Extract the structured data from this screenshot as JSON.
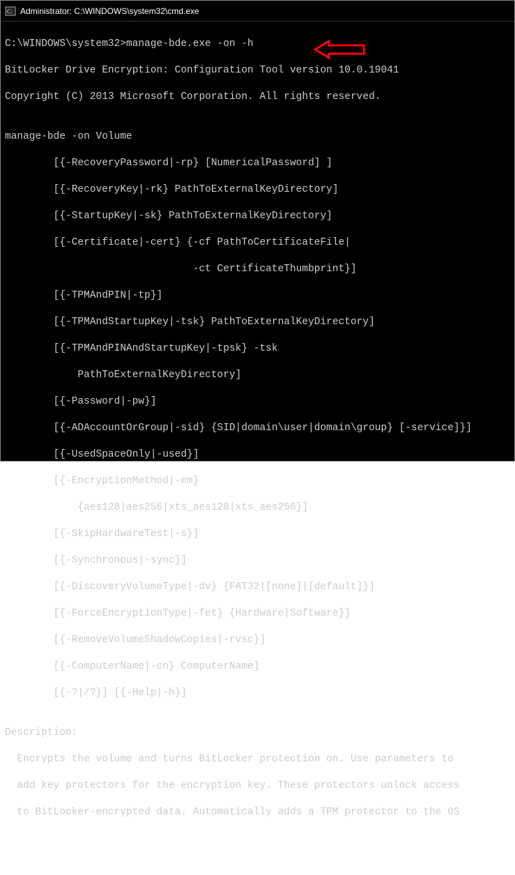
{
  "titlebar": {
    "title": "Administrator: C:\\WINDOWS\\system32\\cmd.exe"
  },
  "terminal": {
    "prompt": "C:\\WINDOWS\\system32>",
    "command": "manage-bde.exe -on -h",
    "output": {
      "l1": "BitLocker Drive Encryption: Configuration Tool version 10.0.19041",
      "l2": "Copyright (C) 2013 Microsoft Corporation. All rights reserved.",
      "l3": "",
      "l4": "manage-bde -on Volume",
      "l5": "        [{-RecoveryPassword|-rp} [NumericalPassword] ]",
      "l6": "        [{-RecoveryKey|-rk} PathToExternalKeyDirectory]",
      "l7": "        [{-StartupKey|-sk} PathToExternalKeyDirectory]",
      "l8": "        [{-Certificate|-cert} {-cf PathToCertificateFile|",
      "l9": "                               -ct CertificateThumbprint}]",
      "l10": "        [{-TPMAndPIN|-tp}]",
      "l11": "        [{-TPMAndStartupKey|-tsk} PathToExternalKeyDirectory]",
      "l12": "        [{-TPMAndPINAndStartupKey|-tpsk} -tsk",
      "l13": "            PathToExternalKeyDirectory]",
      "l14": "        [{-Password|-pw}]",
      "l15": "        [{-ADAccountOrGroup|-sid} {SID|domain\\user|domain\\group} [-service]}]",
      "l16": "        [{-UsedSpaceOnly|-used}]",
      "l17": "        [{-EncryptionMethod|-em}",
      "l18": "            {aes128|aes256|xts_aes128|xts_aes256}]",
      "l19": "        [{-SkipHardwareTest|-s}]",
      "l20": "        [{-Synchronous|-sync}]",
      "l21": "        [{-DiscoveryVolumeType|-dv} {FAT32|[none]|[default]}]",
      "l22": "        [{-ForceEncryptionType|-fet} {Hardware|Software}]",
      "l23": "        [{-RemoveVolumeShadowCopies|-rvsc}]",
      "l24": "        [{-ComputerName|-cn} ComputerName]",
      "l25": "        [{-?|/?}] [{-Help|-h}]",
      "l26": "",
      "l27": "Description:",
      "l28": "  Encrypts the volume and turns BitLocker protection on. Use parameters to",
      "l29": "  add key protectors for the encryption key. These protectors unlock access",
      "l30": "  to BitLocker-encrypted data. Automatically adds a TPM protector to the OS"
    }
  },
  "annotation": {
    "arrow_color": "#ff0000"
  }
}
